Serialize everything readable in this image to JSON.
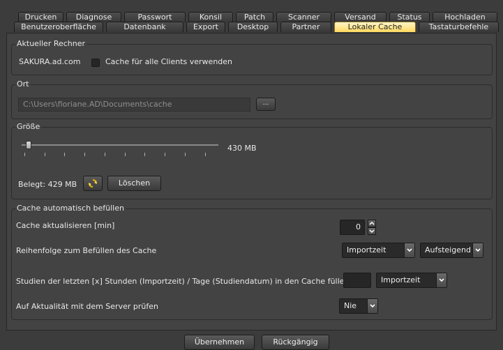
{
  "tabs_row1": [
    "Drucken",
    "Diagnose",
    "Passwort",
    "Konsil",
    "Patch",
    "Scanner",
    "Versand",
    "Status",
    "Hochladen"
  ],
  "tabs_row2": [
    "Benutzeroberfläche",
    "Datenbank",
    "Export",
    "Desktop",
    "Partner",
    "Lokaler Cache",
    "Tastaturbefehle"
  ],
  "active_tab": "Lokaler Cache",
  "current_computer": {
    "title": "Aktueller Rechner",
    "host": "SAKURA.ad.com",
    "checkbox_label": "Cache für alle Clients verwenden",
    "checked": false
  },
  "location": {
    "title": "Ort",
    "path": "C:\\Users\\floriane.AD\\Documents\\cache",
    "browse_label": "..."
  },
  "size": {
    "title": "Größe",
    "slider_value_label": "430 MB",
    "slider_level": 0.02,
    "used_label": "Belegt: 429 MB",
    "refresh_icon": "refresh-icon",
    "delete_label": "Löschen"
  },
  "autofill": {
    "title": "Cache automatisch befüllen",
    "refresh_label": "Cache aktualisieren [min]",
    "refresh_value": "0",
    "order_label": "Reihenfolge zum Befüllen des Cache",
    "order_field": "Importzeit",
    "order_direction": "Aufsteigend",
    "studies_label": "Studien der letzten [x] Stunden (Importzeit) / Tage (Studiendatum) in den Cache füllen",
    "studies_value": "",
    "studies_type": "Importzeit",
    "check_label": "Auf Aktualität mit dem Server prüfen",
    "check_value": "Nie"
  },
  "footer": {
    "apply_label": "Übernehmen",
    "revert_label": "Rückgängig"
  },
  "colors": {
    "active_tab": "#ffd95e",
    "background": "#3c3c3c",
    "panel": "#434343"
  }
}
